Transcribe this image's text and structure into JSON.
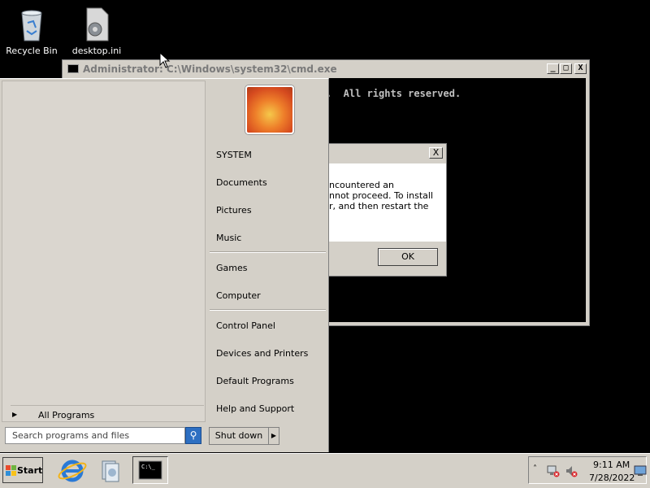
{
  "desktop": {
    "icons": [
      {
        "label": "Recycle Bin",
        "icon": "recycle-bin-icon"
      },
      {
        "label": "desktop.ini",
        "icon": "settings-file-icon"
      }
    ]
  },
  "cmd_window": {
    "title": "Administrator: C:\\Windows\\system32\\cmd.exe",
    "visible_text": ".  All rights reserved.",
    "buttons": {
      "minimize": "_",
      "maximize": "□",
      "close": "X"
    }
  },
  "error_dialog": {
    "message_lines": [
      "ncountered an",
      "nnot proceed. To install",
      "r, and then restart the"
    ],
    "ok_label": "OK",
    "close_label": "X"
  },
  "start_menu": {
    "all_programs": "All Programs",
    "search_placeholder": "Search programs and files",
    "right_items": [
      "SYSTEM",
      "Documents",
      "Pictures",
      "Music",
      "Games",
      "Computer",
      "Control Panel",
      "Devices and Printers",
      "Default Programs",
      "Help and Support"
    ],
    "shutdown_label": "Shut down"
  },
  "taskbar": {
    "start_label": "Start",
    "apps": [
      "internet-explorer-icon",
      "windows-explorer-icon",
      "command-prompt-icon"
    ],
    "clock": {
      "time": "9:11 AM",
      "date": "7/28/2022"
    }
  }
}
